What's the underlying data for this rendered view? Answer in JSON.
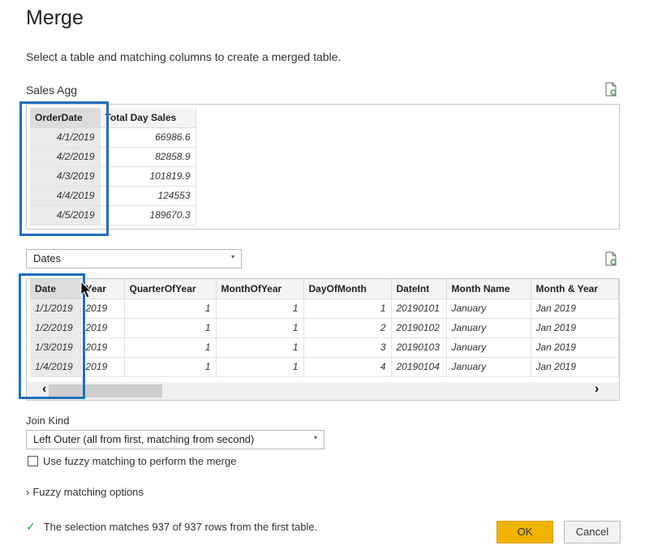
{
  "dialog": {
    "title": "Merge",
    "subtitle": "Select a table and matching columns to create a merged table.",
    "close_icon": "×"
  },
  "first_table": {
    "name": "Sales Agg",
    "columns": [
      "OrderDate",
      "Total Day Sales"
    ],
    "rows": [
      [
        "4/1/2019",
        "66986.6"
      ],
      [
        "4/2/2019",
        "82858.9"
      ],
      [
        "4/3/2019",
        "101819.9"
      ],
      [
        "4/4/2019",
        "124553"
      ],
      [
        "4/5/2019",
        "189670.3"
      ]
    ]
  },
  "second_table": {
    "selected": "Dates",
    "columns": [
      "Date",
      "Year",
      "QuarterOfYear",
      "MonthOfYear",
      "DayOfMonth",
      "DateInt",
      "Month Name",
      "Month & Year"
    ],
    "rows": [
      [
        "1/1/2019",
        "2019",
        "1",
        "1",
        "1",
        "20190101",
        "January",
        "Jan 2019"
      ],
      [
        "1/2/2019",
        "2019",
        "1",
        "1",
        "2",
        "20190102",
        "January",
        "Jan 2019"
      ],
      [
        "1/3/2019",
        "2019",
        "1",
        "1",
        "3",
        "20190103",
        "January",
        "Jan 2019"
      ],
      [
        "1/4/2019",
        "2019",
        "1",
        "1",
        "4",
        "20190104",
        "January",
        "Jan 2019"
      ]
    ]
  },
  "join": {
    "label": "Join Kind",
    "selected": "Left Outer (all from first, matching from second)",
    "fuzzy_checkbox_label": "Use fuzzy matching to perform the merge",
    "fuzzy_checked": false,
    "fuzzy_options_label": "Fuzzy matching options"
  },
  "status": {
    "text": "The selection matches 937 of 937 rows from the first table."
  },
  "buttons": {
    "ok": "OK",
    "cancel": "Cancel"
  },
  "icons": {
    "preview_icon": "document-refresh-icon",
    "scroll_left": "‹",
    "scroll_right": "›",
    "dropdown": "▾",
    "chevron": "›",
    "check": "✓"
  },
  "colors": {
    "accent_ok": "#efb300",
    "highlight": "#1f6fbf",
    "success": "#1a9c3c"
  }
}
